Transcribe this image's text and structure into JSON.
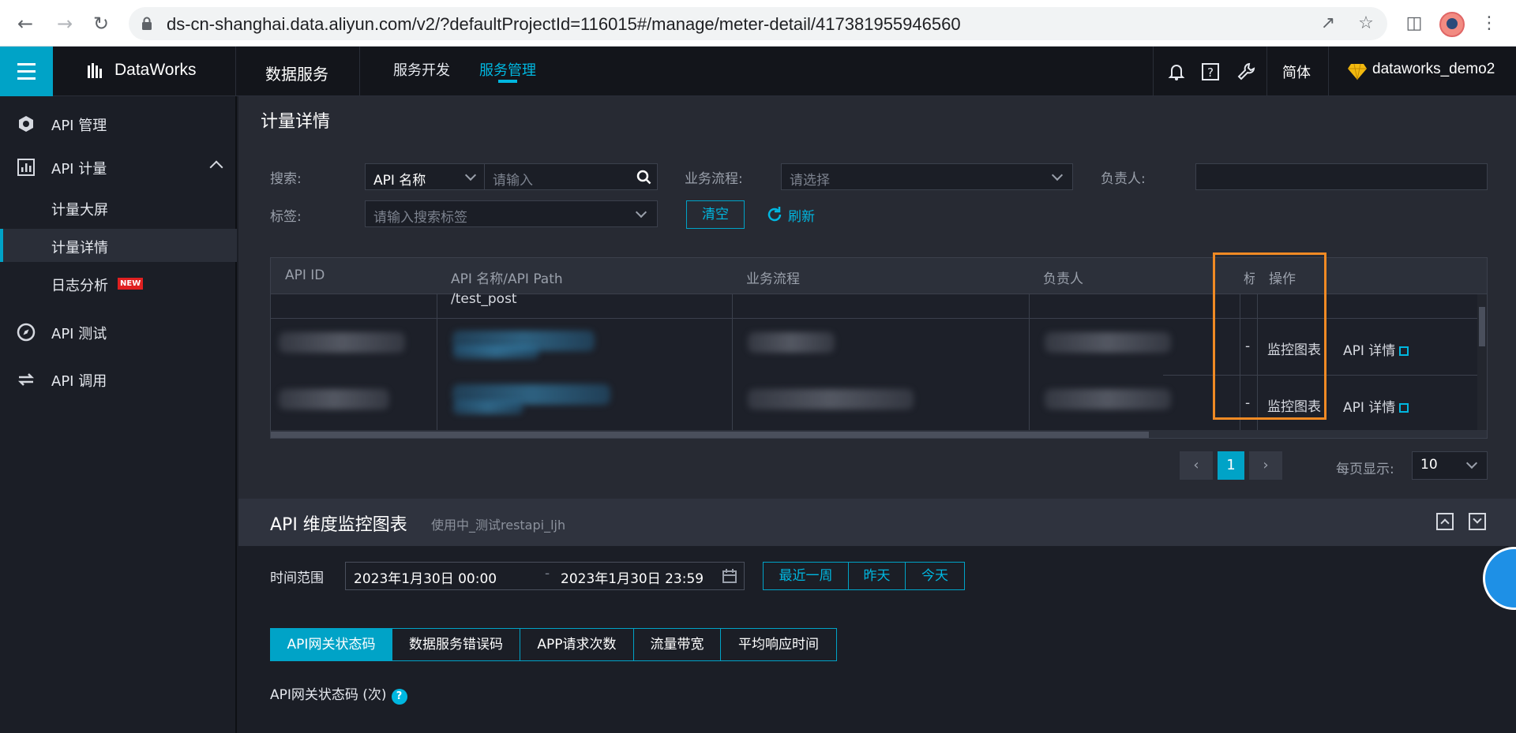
{
  "browser": {
    "url": "ds-cn-shanghai.data.aliyun.com/v2/?defaultProjectId=116015#/manage/meter-detail/417381955946560"
  },
  "topbar": {
    "brand": "DataWorks",
    "product": "数据服务",
    "nav": [
      "服务开发",
      "服务管理"
    ],
    "active_nav": "服务管理",
    "language": "简体",
    "user": "dataworks_demo2"
  },
  "sidebar": {
    "items": [
      {
        "label": "API 管理",
        "icon": "hexagon-icon"
      },
      {
        "label": "API 计量",
        "icon": "bar-chart-icon",
        "expanded": true,
        "children": [
          {
            "label": "计量大屏"
          },
          {
            "label": "计量详情",
            "active": true
          },
          {
            "label": "日志分析",
            "badge": "NEW"
          }
        ]
      },
      {
        "label": "API 测试",
        "icon": "compass-icon"
      },
      {
        "label": "API 调用",
        "icon": "swap-icon"
      }
    ]
  },
  "page": {
    "title": "计量详情",
    "filters": {
      "search_label": "搜索:",
      "search_type": "API 名称",
      "search_placeholder": "请输入",
      "flow_label": "业务流程:",
      "flow_placeholder": "请选择",
      "owner_label": "负责人:",
      "owner_value": "",
      "tag_label": "标签:",
      "tag_placeholder": "请输入搜索标签",
      "clear": "清空",
      "refresh": "刷新"
    },
    "table": {
      "columns": [
        "API ID",
        "API 名称/API Path",
        "业务流程",
        "负责人",
        "标",
        "操作"
      ],
      "rows": [
        {
          "path": "/test_post",
          "tag": "",
          "monitor": "",
          "detail": ""
        },
        {
          "path": "",
          "tag": "-",
          "monitor": "监控图表",
          "detail": "API 详情"
        },
        {
          "path": "",
          "tag": "-",
          "monitor": "监控图表",
          "detail": "API 详情"
        }
      ]
    },
    "pagination": {
      "current": "1",
      "page_size_label": "每页显示:",
      "page_size": "10"
    }
  },
  "monitor": {
    "title": "API 维度监控图表",
    "subtitle": "使用中_测试restapi_ljh",
    "time_label": "时间范围",
    "start": "2023年1月30日 00:00",
    "separator": "-",
    "end": "2023年1月30日 23:59",
    "quick_ranges": [
      "最近一周",
      "昨天",
      "今天"
    ],
    "tabs": [
      "API网关状态码",
      "数据服务错误码",
      "APP请求次数",
      "流量带宽",
      "平均响应时间"
    ],
    "active_tab": "API网关状态码",
    "chart_title": "API网关状态码 (次)",
    "help": "?"
  },
  "colors": {
    "accent": "#00a3c7",
    "highlight": "#f08a24"
  }
}
